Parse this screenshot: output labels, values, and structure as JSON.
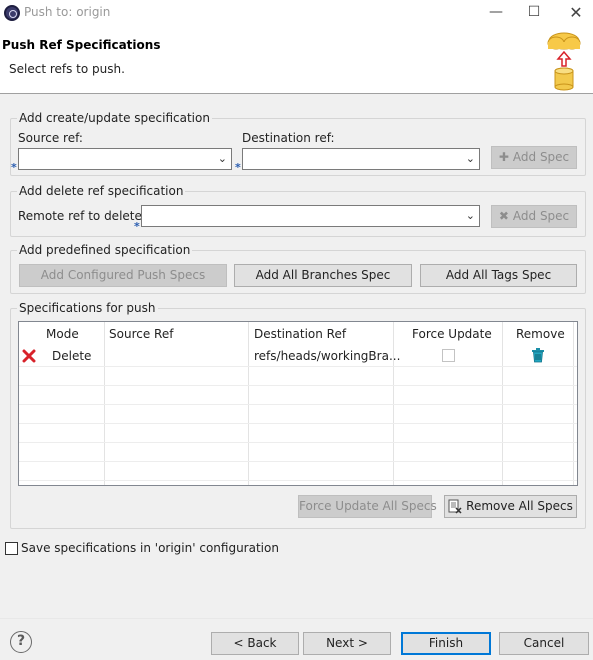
{
  "window": {
    "title": "Push to: origin"
  },
  "banner": {
    "title": "Push Ref Specifications",
    "subtitle": "Select refs to push."
  },
  "create_update": {
    "legend": "Add create/update specification",
    "source_label": "Source ref:",
    "destination_label": "Destination ref:",
    "add_spec_label": "Add Spec"
  },
  "delete_ref": {
    "legend": "Add delete ref specification",
    "remote_label": "Remote ref to delete:",
    "add_spec_label": "Add Spec"
  },
  "predefined": {
    "legend": "Add predefined specification",
    "configured_label": "Add Configured Push Specs",
    "branches_label": "Add All Branches Spec",
    "tags_label": "Add All Tags Spec"
  },
  "specs": {
    "legend": "Specifications for push",
    "columns": [
      "Mode",
      "Source Ref",
      "Destination Ref",
      "Force Update",
      "Remove"
    ],
    "rows": [
      {
        "mode": "Delete",
        "source_ref": "",
        "destination_ref": "refs/heads/workingBra...",
        "force_update": false
      }
    ],
    "force_update_all_label": "Force Update All Specs",
    "remove_all_label": "Remove All Specs"
  },
  "save_config_label": "Save specifications in 'origin' configuration",
  "save_config_checked": false,
  "footer": {
    "back": "< Back",
    "next": "Next >",
    "finish": "Finish",
    "cancel": "Cancel"
  },
  "colors": {
    "accent": "#0078d7",
    "delete_red": "#d8222a",
    "trash_teal": "#1b8fa8"
  }
}
